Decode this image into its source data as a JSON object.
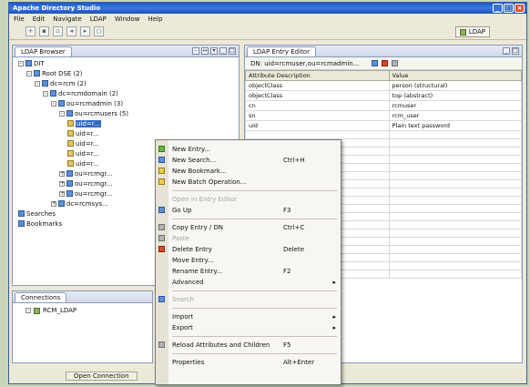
{
  "window": {
    "title": "Apache Directory Studio"
  },
  "menu": [
    "File",
    "Edit",
    "Navigate",
    "LDAP",
    "Window",
    "Help"
  ],
  "perspective_label": "LDAP",
  "browser": {
    "tab_label": "LDAP Browser",
    "tree": [
      {
        "label": "DIT",
        "level": 0,
        "twisty": "-"
      },
      {
        "label": "Root DSE (2)",
        "level": 1,
        "twisty": "-"
      },
      {
        "label": "dc=rcm (2)",
        "level": 2,
        "twisty": "-"
      },
      {
        "label": "dc=rcmdomain (2)",
        "level": 3,
        "twisty": "-"
      },
      {
        "label": "ou=rcmadmin (3)",
        "level": 4,
        "twisty": "-"
      },
      {
        "label": "ou=rcmusers (5)",
        "level": 5,
        "twisty": "-"
      },
      {
        "label": "uid=r...",
        "level": 6,
        "twisty": "",
        "selected": true
      },
      {
        "label": "uid=r...",
        "level": 6,
        "twisty": ""
      },
      {
        "label": "uid=r...",
        "level": 6,
        "twisty": ""
      },
      {
        "label": "uid=r...",
        "level": 6,
        "twisty": ""
      },
      {
        "label": "uid=r...",
        "level": 6,
        "twisty": ""
      },
      {
        "label": "ou=rcmgr...",
        "level": 5,
        "twisty": "+"
      },
      {
        "label": "ou=rcmgr...",
        "level": 5,
        "twisty": "+"
      },
      {
        "label": "ou=rcmgr...",
        "level": 5,
        "twisty": "+"
      },
      {
        "label": "dc=rcmsys...",
        "level": 4,
        "twisty": "+"
      },
      {
        "label": "Searches",
        "level": 0,
        "twisty": ""
      },
      {
        "label": "Bookmarks",
        "level": 0,
        "twisty": ""
      }
    ]
  },
  "connections": {
    "tab_label": "Connections",
    "item": "RCM_LDAP",
    "status_button": "Open Connection"
  },
  "editor": {
    "tab_label": "LDAP Entry Editor",
    "dn_label": "DN: uid=rcmuser,ou=rcmadmin...",
    "columns": [
      "Attribute Description",
      "Value"
    ],
    "rows": [
      [
        "objectClass",
        "person (structural)"
      ],
      [
        "objectClass",
        "top (abstract)"
      ],
      [
        "cn",
        "rcmuser"
      ],
      [
        "sn",
        "rcm_user"
      ],
      [
        "uid",
        "Plain text password"
      ]
    ],
    "empty_rows": 18
  },
  "context_menu": [
    {
      "label": "New Entry...",
      "key": "",
      "icon": "new-entry-icon",
      "color": "ic-green"
    },
    {
      "label": "New Search...",
      "key": "Ctrl+H",
      "icon": "new-search-icon",
      "color": "ic-blue"
    },
    {
      "label": "New Bookmark...",
      "key": "",
      "icon": "new-bookmark-icon",
      "color": "ic-yellow"
    },
    {
      "label": "New Batch Operation...",
      "key": "",
      "icon": "batch-icon",
      "color": "ic-yellow"
    },
    {
      "sep": true
    },
    {
      "label": "Open in Entry Editor",
      "key": "",
      "icon": "",
      "dim": true
    },
    {
      "label": "Go Up",
      "key": "F3",
      "icon": "go-up-icon",
      "color": "ic-blue"
    },
    {
      "sep": true
    },
    {
      "label": "Copy Entry / DN",
      "key": "Ctrl+C",
      "icon": "copy-icon",
      "color": "ic-grey"
    },
    {
      "label": "Paste",
      "key": "",
      "icon": "paste-icon",
      "color": "ic-grey",
      "dim": true
    },
    {
      "label": "Delete Entry",
      "key": "Delete",
      "icon": "delete-icon",
      "color": "ic-red"
    },
    {
      "label": "Move Entry...",
      "key": "",
      "icon": "",
      "color": ""
    },
    {
      "label": "Rename Entry...",
      "key": "F2",
      "icon": "",
      "color": ""
    },
    {
      "label": "Advanced",
      "key": "",
      "icon": "",
      "arrow": true
    },
    {
      "sep": true
    },
    {
      "label": "Search",
      "key": "",
      "icon": "search-icon",
      "color": "ic-blue",
      "dim": true
    },
    {
      "sep": true
    },
    {
      "label": "Import",
      "key": "",
      "icon": "",
      "arrow": true
    },
    {
      "label": "Export",
      "key": "",
      "icon": "",
      "arrow": true
    },
    {
      "sep": true
    },
    {
      "label": "Reload Attributes and Children",
      "key": "F5",
      "icon": "reload-icon",
      "color": "ic-grey"
    },
    {
      "sep": true
    },
    {
      "label": "Properties",
      "key": "Alt+Enter",
      "icon": "",
      "color": ""
    }
  ]
}
